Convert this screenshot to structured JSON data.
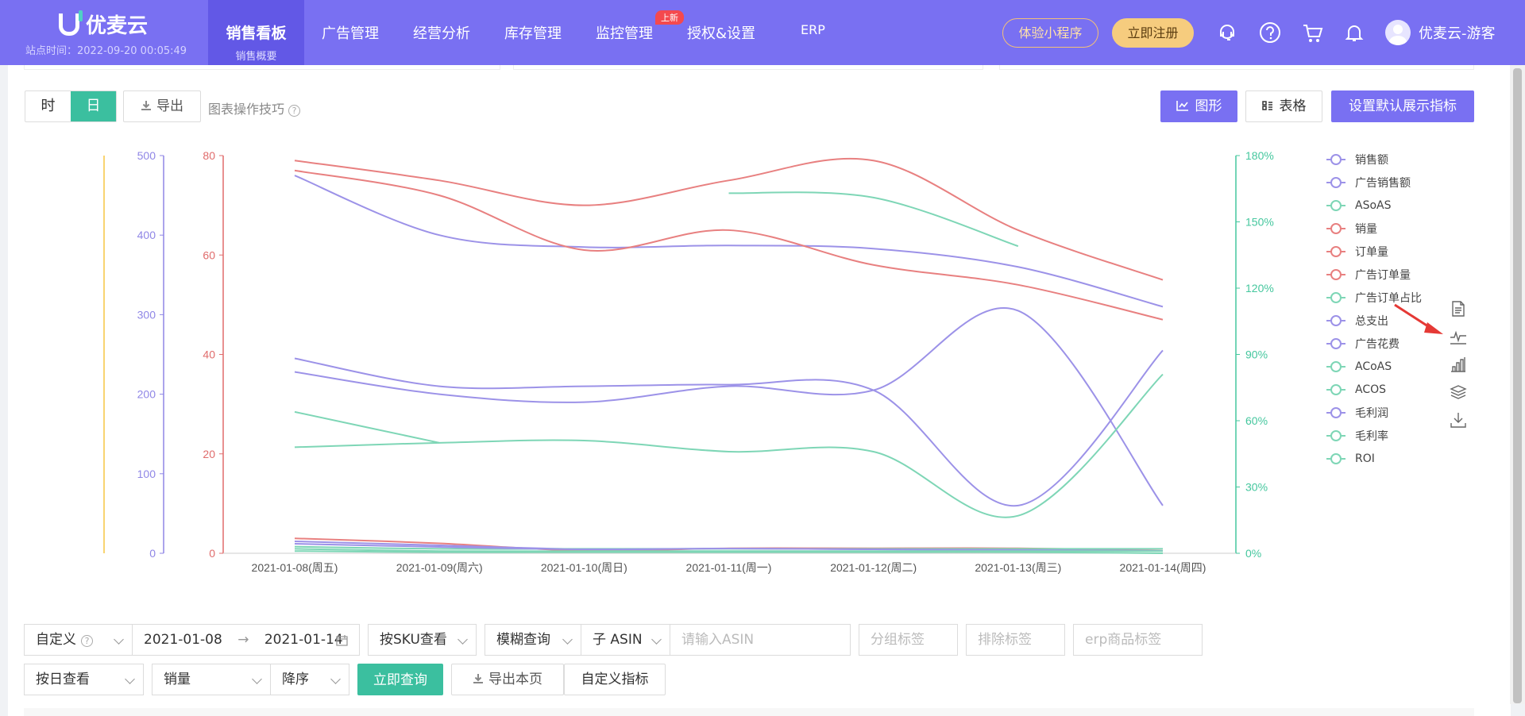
{
  "header": {
    "app_name": "优麦云",
    "site_time": "站点时间：2022-09-20 00:05:49",
    "nav_active": {
      "label": "销售看板",
      "sub": "销售概要"
    },
    "nav": [
      "广告管理",
      "经营分析",
      "库存管理",
      "监控管理",
      "授权&设置",
      "ERP"
    ],
    "new_badge": "上新",
    "mini_program": "体验小程序",
    "register": "立即注册",
    "user": "优麦云-游客"
  },
  "toolbar": {
    "granularity": [
      "时",
      "日"
    ],
    "export": "导出",
    "chart_tips": "图表操作技巧",
    "view_chart": "图形",
    "view_table": "表格",
    "set_default": "设置默认展示指标"
  },
  "chart_data": {
    "type": "line",
    "categories": [
      "2021-01-08(周五)",
      "2021-01-09(周六)",
      "2021-01-10(周日)",
      "2021-01-11(周一)",
      "2021-01-12(周二)",
      "2021-01-13(周三)",
      "2021-01-14(周四)"
    ],
    "axes": {
      "money": {
        "ticks": [
          "0",
          "100",
          "200",
          "300",
          "400",
          "500"
        ],
        "range": [
          0,
          500
        ],
        "color": "#8f86e6"
      },
      "count": {
        "ticks": [
          "0",
          "20",
          "40",
          "60",
          "80"
        ],
        "range": [
          0,
          80
        ],
        "color": "#e06c6c"
      },
      "percent": {
        "ticks": [
          "0%",
          "30%",
          "60%",
          "90%",
          "120%",
          "150%",
          "180%"
        ],
        "range": [
          0,
          180
        ],
        "color": "#45c79e"
      }
    },
    "series": [
      {
        "name": "销售额",
        "axis": "money",
        "color": "#9c92e8",
        "values": [
          475,
          400,
          385,
          387,
          383,
          360,
          310
        ]
      },
      {
        "name": "广告销售额",
        "axis": "money",
        "color": "#9c92e8",
        "values": [
          228,
          200,
          190,
          210,
          205,
          305,
          60
        ]
      },
      {
        "name": "ASoAS",
        "axis": "percent",
        "color": "#7ed6b6",
        "values": [
          null,
          null,
          null,
          163,
          161,
          139,
          null
        ]
      },
      {
        "name": "销量",
        "axis": "count",
        "color": "#e88080",
        "values": [
          79,
          75,
          70,
          75,
          79,
          65,
          55
        ]
      },
      {
        "name": "订单量",
        "axis": "count",
        "color": "#e88080",
        "values": [
          77,
          72,
          61,
          65,
          58,
          54,
          47
        ]
      },
      {
        "name": "广告订单量",
        "axis": "count",
        "color": "#e88080",
        "values": [
          3,
          2,
          0.5,
          1,
          1,
          1,
          0.5
        ]
      },
      {
        "name": "广告订单占比",
        "axis": "percent",
        "color": "#7ed6b6",
        "values": [
          64,
          50,
          null,
          null,
          null,
          null,
          null
        ]
      },
      {
        "name": "总支出",
        "axis": "money",
        "color": "#9c92e8",
        "values": [
          245,
          210,
          210,
          212,
          205,
          60,
          255
        ]
      },
      {
        "name": "广告花费",
        "axis": "money",
        "color": "#9c92e8",
        "values": [
          15,
          10,
          5,
          6,
          5,
          4,
          3
        ]
      },
      {
        "name": "ACoAS",
        "axis": "percent",
        "color": "#7ed6b6",
        "values": [
          48,
          50,
          51,
          46,
          46,
          17,
          81
        ]
      },
      {
        "name": "ACOS",
        "axis": "percent",
        "color": "#7ed6b6",
        "values": [
          3,
          2,
          2,
          2,
          2,
          2,
          2
        ]
      },
      {
        "name": "毛利润",
        "axis": "money",
        "color": "#9c92e8",
        "values": [
          12,
          8,
          5,
          6,
          5,
          4,
          3
        ]
      },
      {
        "name": "毛利率",
        "axis": "percent",
        "color": "#7ed6b6",
        "values": [
          2,
          1,
          1,
          1,
          1,
          1,
          1
        ]
      },
      {
        "name": "ROI",
        "axis": "percent",
        "color": "#7ed6b6",
        "values": [
          1,
          0.5,
          0.5,
          0.5,
          0.5,
          0.5,
          0
        ]
      }
    ],
    "legend_placement": "right"
  },
  "filters": {
    "range_type": "自定义",
    "date_start": "2021-01-08",
    "date_end": "2021-01-14",
    "date_sep": "→",
    "view_by": "按SKU查看",
    "match": "模糊查询",
    "asin_type": "子 ASIN",
    "asin_placeholder": "请输入ASIN",
    "group_tag": "分组标签",
    "exclude_tag": "排除标签",
    "erp_tag": "erp商品标签",
    "period": "按日查看",
    "sort_field": "销量",
    "sort_order": "降序",
    "query": "立即查询",
    "export_page": "导出本页",
    "custom_metrics": "自定义指标"
  }
}
